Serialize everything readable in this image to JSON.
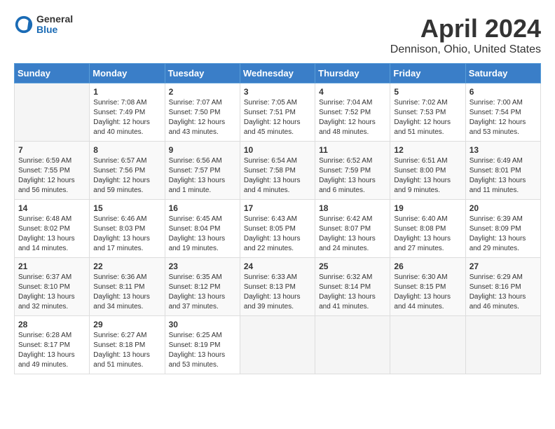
{
  "header": {
    "logo_general": "General",
    "logo_blue": "Blue",
    "month_year": "April 2024",
    "location": "Dennison, Ohio, United States"
  },
  "days_of_week": [
    "Sunday",
    "Monday",
    "Tuesday",
    "Wednesday",
    "Thursday",
    "Friday",
    "Saturday"
  ],
  "weeks": [
    [
      {
        "day": "",
        "sunrise": "",
        "sunset": "",
        "daylight": ""
      },
      {
        "day": "1",
        "sunrise": "Sunrise: 7:08 AM",
        "sunset": "Sunset: 7:49 PM",
        "daylight": "Daylight: 12 hours and 40 minutes."
      },
      {
        "day": "2",
        "sunrise": "Sunrise: 7:07 AM",
        "sunset": "Sunset: 7:50 PM",
        "daylight": "Daylight: 12 hours and 43 minutes."
      },
      {
        "day": "3",
        "sunrise": "Sunrise: 7:05 AM",
        "sunset": "Sunset: 7:51 PM",
        "daylight": "Daylight: 12 hours and 45 minutes."
      },
      {
        "day": "4",
        "sunrise": "Sunrise: 7:04 AM",
        "sunset": "Sunset: 7:52 PM",
        "daylight": "Daylight: 12 hours and 48 minutes."
      },
      {
        "day": "5",
        "sunrise": "Sunrise: 7:02 AM",
        "sunset": "Sunset: 7:53 PM",
        "daylight": "Daylight: 12 hours and 51 minutes."
      },
      {
        "day": "6",
        "sunrise": "Sunrise: 7:00 AM",
        "sunset": "Sunset: 7:54 PM",
        "daylight": "Daylight: 12 hours and 53 minutes."
      }
    ],
    [
      {
        "day": "7",
        "sunrise": "Sunrise: 6:59 AM",
        "sunset": "Sunset: 7:55 PM",
        "daylight": "Daylight: 12 hours and 56 minutes."
      },
      {
        "day": "8",
        "sunrise": "Sunrise: 6:57 AM",
        "sunset": "Sunset: 7:56 PM",
        "daylight": "Daylight: 12 hours and 59 minutes."
      },
      {
        "day": "9",
        "sunrise": "Sunrise: 6:56 AM",
        "sunset": "Sunset: 7:57 PM",
        "daylight": "Daylight: 13 hours and 1 minute."
      },
      {
        "day": "10",
        "sunrise": "Sunrise: 6:54 AM",
        "sunset": "Sunset: 7:58 PM",
        "daylight": "Daylight: 13 hours and 4 minutes."
      },
      {
        "day": "11",
        "sunrise": "Sunrise: 6:52 AM",
        "sunset": "Sunset: 7:59 PM",
        "daylight": "Daylight: 13 hours and 6 minutes."
      },
      {
        "day": "12",
        "sunrise": "Sunrise: 6:51 AM",
        "sunset": "Sunset: 8:00 PM",
        "daylight": "Daylight: 13 hours and 9 minutes."
      },
      {
        "day": "13",
        "sunrise": "Sunrise: 6:49 AM",
        "sunset": "Sunset: 8:01 PM",
        "daylight": "Daylight: 13 hours and 11 minutes."
      }
    ],
    [
      {
        "day": "14",
        "sunrise": "Sunrise: 6:48 AM",
        "sunset": "Sunset: 8:02 PM",
        "daylight": "Daylight: 13 hours and 14 minutes."
      },
      {
        "day": "15",
        "sunrise": "Sunrise: 6:46 AM",
        "sunset": "Sunset: 8:03 PM",
        "daylight": "Daylight: 13 hours and 17 minutes."
      },
      {
        "day": "16",
        "sunrise": "Sunrise: 6:45 AM",
        "sunset": "Sunset: 8:04 PM",
        "daylight": "Daylight: 13 hours and 19 minutes."
      },
      {
        "day": "17",
        "sunrise": "Sunrise: 6:43 AM",
        "sunset": "Sunset: 8:05 PM",
        "daylight": "Daylight: 13 hours and 22 minutes."
      },
      {
        "day": "18",
        "sunrise": "Sunrise: 6:42 AM",
        "sunset": "Sunset: 8:07 PM",
        "daylight": "Daylight: 13 hours and 24 minutes."
      },
      {
        "day": "19",
        "sunrise": "Sunrise: 6:40 AM",
        "sunset": "Sunset: 8:08 PM",
        "daylight": "Daylight: 13 hours and 27 minutes."
      },
      {
        "day": "20",
        "sunrise": "Sunrise: 6:39 AM",
        "sunset": "Sunset: 8:09 PM",
        "daylight": "Daylight: 13 hours and 29 minutes."
      }
    ],
    [
      {
        "day": "21",
        "sunrise": "Sunrise: 6:37 AM",
        "sunset": "Sunset: 8:10 PM",
        "daylight": "Daylight: 13 hours and 32 minutes."
      },
      {
        "day": "22",
        "sunrise": "Sunrise: 6:36 AM",
        "sunset": "Sunset: 8:11 PM",
        "daylight": "Daylight: 13 hours and 34 minutes."
      },
      {
        "day": "23",
        "sunrise": "Sunrise: 6:35 AM",
        "sunset": "Sunset: 8:12 PM",
        "daylight": "Daylight: 13 hours and 37 minutes."
      },
      {
        "day": "24",
        "sunrise": "Sunrise: 6:33 AM",
        "sunset": "Sunset: 8:13 PM",
        "daylight": "Daylight: 13 hours and 39 minutes."
      },
      {
        "day": "25",
        "sunrise": "Sunrise: 6:32 AM",
        "sunset": "Sunset: 8:14 PM",
        "daylight": "Daylight: 13 hours and 41 minutes."
      },
      {
        "day": "26",
        "sunrise": "Sunrise: 6:30 AM",
        "sunset": "Sunset: 8:15 PM",
        "daylight": "Daylight: 13 hours and 44 minutes."
      },
      {
        "day": "27",
        "sunrise": "Sunrise: 6:29 AM",
        "sunset": "Sunset: 8:16 PM",
        "daylight": "Daylight: 13 hours and 46 minutes."
      }
    ],
    [
      {
        "day": "28",
        "sunrise": "Sunrise: 6:28 AM",
        "sunset": "Sunset: 8:17 PM",
        "daylight": "Daylight: 13 hours and 49 minutes."
      },
      {
        "day": "29",
        "sunrise": "Sunrise: 6:27 AM",
        "sunset": "Sunset: 8:18 PM",
        "daylight": "Daylight: 13 hours and 51 minutes."
      },
      {
        "day": "30",
        "sunrise": "Sunrise: 6:25 AM",
        "sunset": "Sunset: 8:19 PM",
        "daylight": "Daylight: 13 hours and 53 minutes."
      },
      {
        "day": "",
        "sunrise": "",
        "sunset": "",
        "daylight": ""
      },
      {
        "day": "",
        "sunrise": "",
        "sunset": "",
        "daylight": ""
      },
      {
        "day": "",
        "sunrise": "",
        "sunset": "",
        "daylight": ""
      },
      {
        "day": "",
        "sunrise": "",
        "sunset": "",
        "daylight": ""
      }
    ]
  ]
}
